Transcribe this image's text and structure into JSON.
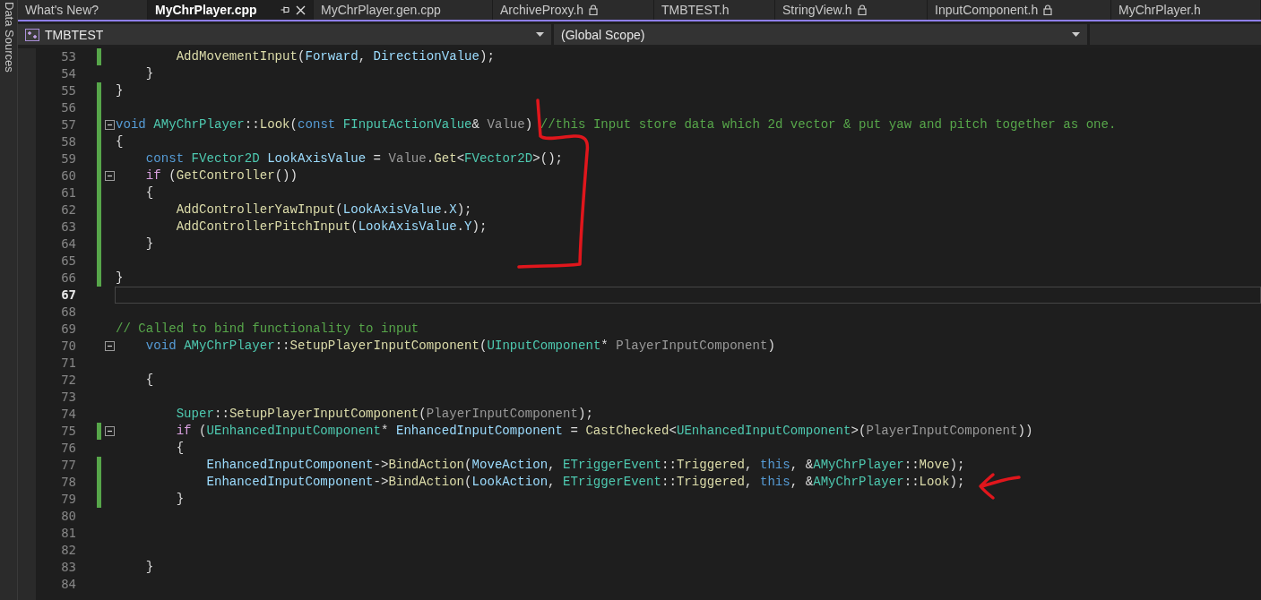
{
  "sidebar_tab": {
    "label": "Data Sources"
  },
  "tabs": [
    {
      "label": "What's New?",
      "selected": false,
      "locked": false
    },
    {
      "label": "MyChrPlayer.cpp",
      "selected": true,
      "locked": false
    },
    {
      "label": "MyChrPlayer.gen.cpp",
      "selected": false,
      "locked": false
    },
    {
      "label": "ArchiveProxy.h",
      "selected": false,
      "locked": true
    },
    {
      "label": "TMBTEST.h",
      "selected": false,
      "locked": false
    },
    {
      "label": "StringView.h",
      "selected": false,
      "locked": true
    },
    {
      "label": "InputComponent.h",
      "selected": false,
      "locked": true
    },
    {
      "label": "MyChrPlayer.h",
      "selected": false,
      "locked": false
    }
  ],
  "navigation_bar": {
    "project": "TMBTEST",
    "scope": "(Global Scope)"
  },
  "editor": {
    "lines": [
      {
        "number": "53",
        "changed": true,
        "collapsible": false,
        "current": false,
        "tokens": [
          {
            "kind": "func",
            "text": "        AddMovementInput"
          },
          {
            "kind": "plain",
            "text": "("
          },
          {
            "kind": "var",
            "text": "Forward"
          },
          {
            "kind": "plain",
            "text": ", "
          },
          {
            "kind": "var",
            "text": "DirectionValue"
          },
          {
            "kind": "plain",
            "text": ");"
          }
        ]
      },
      {
        "number": "54",
        "changed": false,
        "collapsible": false,
        "current": false,
        "tokens": [
          {
            "kind": "plain",
            "text": "    }"
          }
        ]
      },
      {
        "number": "55",
        "changed": true,
        "collapsible": false,
        "current": false,
        "tokens": [
          {
            "kind": "plain",
            "text": "}"
          }
        ]
      },
      {
        "number": "56",
        "changed": true,
        "collapsible": false,
        "current": false
      },
      {
        "number": "57",
        "changed": true,
        "collapsible": true,
        "current": false,
        "tokens": [
          {
            "kind": "keyword",
            "text": "void "
          },
          {
            "kind": "type",
            "text": "AMyChrPlayer"
          },
          {
            "kind": "plain",
            "text": "::"
          },
          {
            "kind": "func",
            "text": "Look"
          },
          {
            "kind": "plain",
            "text": "("
          },
          {
            "kind": "keyword",
            "text": "const "
          },
          {
            "kind": "type",
            "text": "FInputActionValue"
          },
          {
            "kind": "plain",
            "text": "& "
          },
          {
            "kind": "param",
            "text": "Value"
          },
          {
            "kind": "plain",
            "text": ") "
          },
          {
            "kind": "comment",
            "text": "//this Input store data which 2d vector & put yaw and pitch together as one."
          }
        ]
      },
      {
        "number": "58",
        "changed": true,
        "collapsible": false,
        "current": false,
        "tokens": [
          {
            "kind": "plain",
            "text": "{"
          }
        ]
      },
      {
        "number": "59",
        "changed": true,
        "collapsible": false,
        "current": false,
        "tokens": [
          {
            "kind": "keyword",
            "text": "    const "
          },
          {
            "kind": "type",
            "text": "FVector2D "
          },
          {
            "kind": "var",
            "text": "LookAxisValue"
          },
          {
            "kind": "plain",
            "text": " = "
          },
          {
            "kind": "param",
            "text": "Value"
          },
          {
            "kind": "plain",
            "text": "."
          },
          {
            "kind": "func",
            "text": "Get"
          },
          {
            "kind": "plain",
            "text": "<"
          },
          {
            "kind": "type",
            "text": "FVector2D"
          },
          {
            "kind": "plain",
            "text": ">();"
          }
        ]
      },
      {
        "number": "60",
        "changed": true,
        "collapsible": true,
        "current": false,
        "tokens": [
          {
            "kind": "control",
            "text": "    if"
          },
          {
            "kind": "plain",
            "text": " ("
          },
          {
            "kind": "func",
            "text": "GetController"
          },
          {
            "kind": "plain",
            "text": "())"
          }
        ]
      },
      {
        "number": "61",
        "changed": true,
        "collapsible": false,
        "current": false,
        "tokens": [
          {
            "kind": "plain",
            "text": "    {"
          }
        ]
      },
      {
        "number": "62",
        "changed": true,
        "collapsible": false,
        "current": false,
        "tokens": [
          {
            "kind": "func",
            "text": "        AddControllerYawInput"
          },
          {
            "kind": "plain",
            "text": "("
          },
          {
            "kind": "var",
            "text": "LookAxisValue"
          },
          {
            "kind": "plain",
            "text": "."
          },
          {
            "kind": "var",
            "text": "X"
          },
          {
            "kind": "plain",
            "text": ");"
          }
        ]
      },
      {
        "number": "63",
        "changed": true,
        "collapsible": false,
        "current": false,
        "tokens": [
          {
            "kind": "func",
            "text": "        AddControllerPitchInput"
          },
          {
            "kind": "plain",
            "text": "("
          },
          {
            "kind": "var",
            "text": "LookAxisValue"
          },
          {
            "kind": "plain",
            "text": "."
          },
          {
            "kind": "var",
            "text": "Y"
          },
          {
            "kind": "plain",
            "text": ");"
          }
        ]
      },
      {
        "number": "64",
        "changed": true,
        "collapsible": false,
        "current": false,
        "tokens": [
          {
            "kind": "plain",
            "text": "    }"
          }
        ]
      },
      {
        "number": "65",
        "changed": true,
        "collapsible": false,
        "current": false
      },
      {
        "number": "66",
        "changed": true,
        "collapsible": false,
        "current": false,
        "tokens": [
          {
            "kind": "plain",
            "text": "}"
          }
        ]
      },
      {
        "number": "67",
        "changed": false,
        "collapsible": false,
        "current": true
      },
      {
        "number": "68",
        "changed": false,
        "collapsible": false,
        "current": false
      },
      {
        "number": "69",
        "changed": false,
        "collapsible": false,
        "current": false,
        "tokens": [
          {
            "kind": "comment",
            "text": "// Called to bind functionality to input"
          }
        ]
      },
      {
        "number": "70",
        "changed": false,
        "collapsible": true,
        "current": false,
        "tokens": [
          {
            "kind": "keyword",
            "text": "    void "
          },
          {
            "kind": "type",
            "text": "AMyChrPlayer"
          },
          {
            "kind": "plain",
            "text": "::"
          },
          {
            "kind": "func",
            "text": "SetupPlayerInputComponent"
          },
          {
            "kind": "plain",
            "text": "("
          },
          {
            "kind": "type",
            "text": "UInputComponent"
          },
          {
            "kind": "plain",
            "text": "* "
          },
          {
            "kind": "param",
            "text": "PlayerInputComponent"
          },
          {
            "kind": "plain",
            "text": ")"
          }
        ]
      },
      {
        "number": "71",
        "changed": false,
        "collapsible": false,
        "current": false
      },
      {
        "number": "72",
        "changed": false,
        "collapsible": false,
        "current": false,
        "tokens": [
          {
            "kind": "plain",
            "text": "    {"
          }
        ]
      },
      {
        "number": "73",
        "changed": false,
        "collapsible": false,
        "current": false
      },
      {
        "number": "74",
        "changed": false,
        "collapsible": false,
        "current": false,
        "tokens": [
          {
            "kind": "type",
            "text": "        Super"
          },
          {
            "kind": "plain",
            "text": "::"
          },
          {
            "kind": "func",
            "text": "SetupPlayerInputComponent"
          },
          {
            "kind": "plain",
            "text": "("
          },
          {
            "kind": "param",
            "text": "PlayerInputComponent"
          },
          {
            "kind": "plain",
            "text": ");"
          }
        ]
      },
      {
        "number": "75",
        "changed": true,
        "collapsible": true,
        "current": false,
        "tokens": [
          {
            "kind": "control",
            "text": "        if"
          },
          {
            "kind": "plain",
            "text": " ("
          },
          {
            "kind": "type",
            "text": "UEnhancedInputComponent"
          },
          {
            "kind": "plain",
            "text": "* "
          },
          {
            "kind": "var",
            "text": "EnhancedInputComponent"
          },
          {
            "kind": "plain",
            "text": " = "
          },
          {
            "kind": "func",
            "text": "CastChecked"
          },
          {
            "kind": "plain",
            "text": "<"
          },
          {
            "kind": "type",
            "text": "UEnhancedInputComponent"
          },
          {
            "kind": "plain",
            "text": ">("
          },
          {
            "kind": "param",
            "text": "PlayerInputComponent"
          },
          {
            "kind": "plain",
            "text": "))"
          }
        ]
      },
      {
        "number": "76",
        "changed": false,
        "collapsible": false,
        "current": false,
        "tokens": [
          {
            "kind": "plain",
            "text": "        {"
          }
        ]
      },
      {
        "number": "77",
        "changed": true,
        "collapsible": false,
        "current": false,
        "tokens": [
          {
            "kind": "var",
            "text": "            EnhancedInputComponent"
          },
          {
            "kind": "plain",
            "text": "->"
          },
          {
            "kind": "func",
            "text": "BindAction"
          },
          {
            "kind": "plain",
            "text": "("
          },
          {
            "kind": "var",
            "text": "MoveAction"
          },
          {
            "kind": "plain",
            "text": ", "
          },
          {
            "kind": "type",
            "text": "ETriggerEvent"
          },
          {
            "kind": "plain",
            "text": "::"
          },
          {
            "kind": "func",
            "text": "Triggered"
          },
          {
            "kind": "plain",
            "text": ", "
          },
          {
            "kind": "keyword",
            "text": "this"
          },
          {
            "kind": "plain",
            "text": ", &"
          },
          {
            "kind": "type",
            "text": "AMyChrPlayer"
          },
          {
            "kind": "plain",
            "text": "::"
          },
          {
            "kind": "func",
            "text": "Move"
          },
          {
            "kind": "plain",
            "text": ");"
          }
        ]
      },
      {
        "number": "78",
        "changed": true,
        "collapsible": false,
        "current": false,
        "tokens": [
          {
            "kind": "var",
            "text": "            EnhancedInputComponent"
          },
          {
            "kind": "plain",
            "text": "->"
          },
          {
            "kind": "func",
            "text": "BindAction"
          },
          {
            "kind": "plain",
            "text": "("
          },
          {
            "kind": "var",
            "text": "LookAction"
          },
          {
            "kind": "plain",
            "text": ", "
          },
          {
            "kind": "type",
            "text": "ETriggerEvent"
          },
          {
            "kind": "plain",
            "text": "::"
          },
          {
            "kind": "func",
            "text": "Triggered"
          },
          {
            "kind": "plain",
            "text": ", "
          },
          {
            "kind": "keyword",
            "text": "this"
          },
          {
            "kind": "plain",
            "text": ", &"
          },
          {
            "kind": "type",
            "text": "AMyChrPlayer"
          },
          {
            "kind": "plain",
            "text": "::"
          },
          {
            "kind": "func",
            "text": "Look"
          },
          {
            "kind": "plain",
            "text": ");"
          }
        ]
      },
      {
        "number": "79",
        "changed": true,
        "collapsible": false,
        "current": false,
        "tokens": [
          {
            "kind": "plain",
            "text": "        }"
          }
        ]
      },
      {
        "number": "80",
        "changed": false,
        "collapsible": false,
        "current": false
      },
      {
        "number": "81",
        "changed": false,
        "collapsible": false,
        "current": false
      },
      {
        "number": "82",
        "changed": false,
        "collapsible": false,
        "current": false
      },
      {
        "number": "83",
        "changed": false,
        "collapsible": false,
        "current": false,
        "tokens": [
          {
            "kind": "plain",
            "text": "    }"
          }
        ]
      },
      {
        "number": "84",
        "changed": false,
        "collapsible": false,
        "current": false
      }
    ]
  },
  "annotations": {
    "bracket": {
      "color": "#e0161c"
    },
    "arrow": {
      "color": "#e0161c"
    }
  }
}
